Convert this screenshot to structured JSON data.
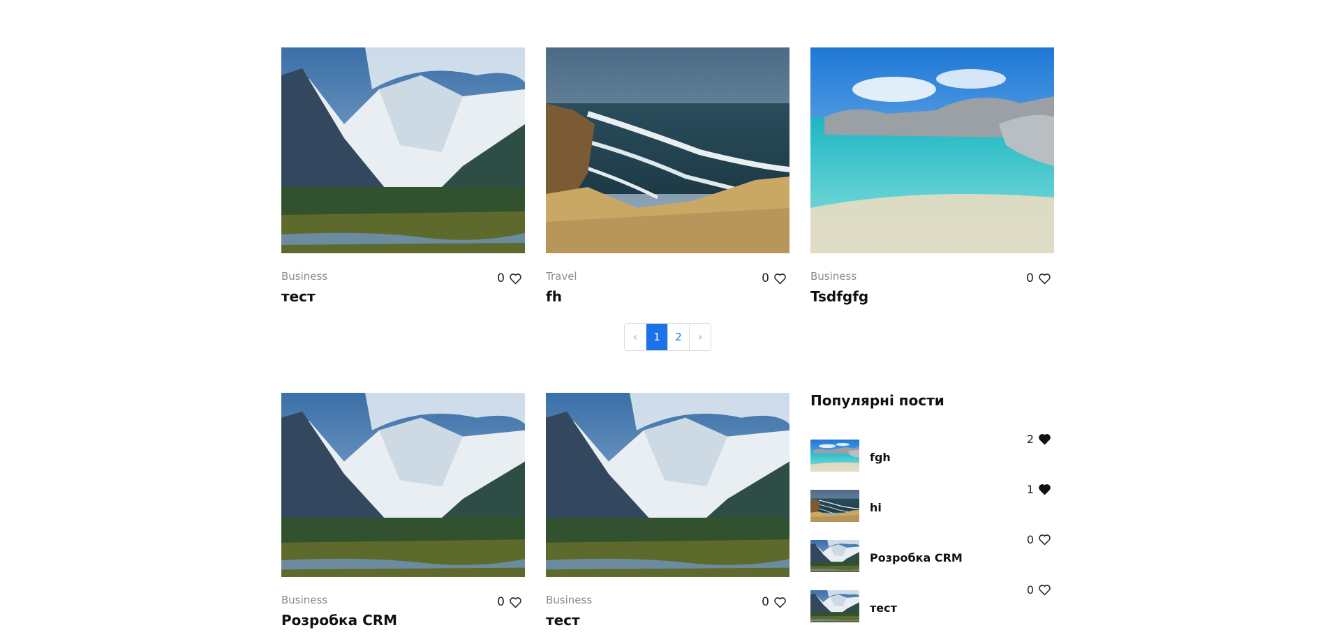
{
  "posts": [
    {
      "category": "Business",
      "likes": "0",
      "title": "тест",
      "image": "mountain-valley"
    },
    {
      "category": "Travel",
      "likes": "0",
      "title": "fh",
      "image": "coastline-cliffs"
    },
    {
      "category": "Business",
      "likes": "0",
      "title": "Tsdfgfg",
      "image": "tropical-beach"
    },
    {
      "category": "Business",
      "likes": "0",
      "title": "Розробка CRM",
      "image": "mountain-valley"
    },
    {
      "category": "Business",
      "likes": "0",
      "title": "тест",
      "image": "mountain-valley"
    }
  ],
  "pagination": {
    "prev": "‹",
    "pages": [
      "1",
      "2"
    ],
    "active": "1",
    "next": "›"
  },
  "popular": {
    "heading": "Популярні пости",
    "items": [
      {
        "title": "fgh",
        "likes": "2",
        "liked": true,
        "image": "tropical-beach"
      },
      {
        "title": "hi",
        "likes": "1",
        "liked": true,
        "image": "coastline-cliffs"
      },
      {
        "title": "Розробка CRM",
        "likes": "0",
        "liked": false,
        "image": "mountain-valley"
      },
      {
        "title": "тест",
        "likes": "0",
        "liked": false,
        "image": "mountain-valley"
      }
    ]
  },
  "colors": {
    "accent": "#1a73e8",
    "category": "#8a8a8a",
    "border": "#dcdcdc"
  },
  "icons": {
    "like": "heart-outline-icon",
    "liked": "heart-filled-icon"
  }
}
